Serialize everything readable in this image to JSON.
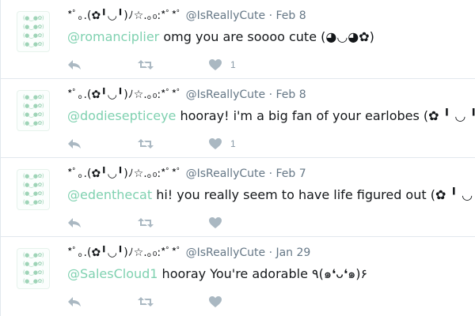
{
  "tweets": [
    {
      "avatar_lines": [
        "(●‿●✿)",
        "(●‿●✿)",
        "(●‿●✿)",
        "(●‿●✿)"
      ],
      "display_name": "*ﾟ｡.(✿╹◡╹)ﾉ☆.｡₀:*ﾟ*ﾟ",
      "handle": "@IsReallyCute",
      "separator": "·",
      "time": "Feb 8",
      "mention": "@romanciplier",
      "text": " omg you are soooo cute (◕◡◕✿)",
      "like_count": "1"
    },
    {
      "avatar_lines": [
        "(●‿●✿)",
        "(●‿●✿)",
        "(●‿●✿)",
        "(●‿●✿)"
      ],
      "display_name": "*ﾟ｡.(✿╹◡╹)ﾉ☆.｡₀:*ﾟ*ﾟ",
      "handle": "@IsReallyCute",
      "separator": "·",
      "time": "Feb 8",
      "mention": "@dodiesepticeye",
      "text": " hooray! i'm a big fan of your earlobes (✿ ╹ ◡ ╹)",
      "like_count": "1"
    },
    {
      "avatar_lines": [
        "(●‿●✿)",
        "(●‿●✿)",
        "(●‿●✿)",
        "(●‿●✿)"
      ],
      "display_name": "*ﾟ｡.(✿╹◡╹)ﾉ☆.｡₀:*ﾟ*ﾟ",
      "handle": "@IsReallyCute",
      "separator": "·",
      "time": "Feb 7",
      "mention": "@edenthecat",
      "text": " hi! you really seem to have life figured out (✿ ╹ ◡ ╹)",
      "like_count": ""
    },
    {
      "avatar_lines": [
        "(●‿●✿)",
        "(●‿●✿)",
        "(●‿●✿)",
        "(●‿●✿)"
      ],
      "display_name": "*ﾟ｡.(✿╹◡╹)ﾉ☆.｡₀:*ﾟ*ﾟ",
      "handle": "@IsReallyCute",
      "separator": "·",
      "time": "Jan 29",
      "mention": "@SalesCloud1",
      "text": " hooray You're adorable ٩(๑❛ᴗ❛๑)۶",
      "like_count": ""
    }
  ],
  "colors": {
    "mention": "#7fd1b0",
    "meta": "#657786",
    "action_icon": "#aab8c2",
    "divider": "#e1e8ed"
  },
  "icons": {
    "reply": "reply-icon",
    "retweet": "retweet-icon",
    "like": "heart-icon"
  }
}
